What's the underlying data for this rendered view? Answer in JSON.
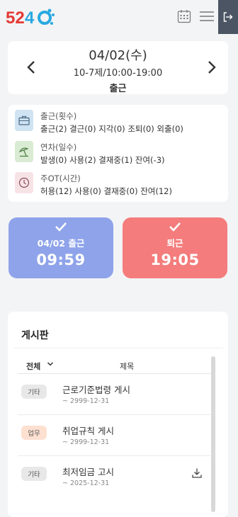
{
  "header": {
    "logo_text": "5240",
    "colors": {
      "logo_red": "#e53935",
      "logo_blue": "#29a9e0",
      "logout_bg": "#4b5563"
    }
  },
  "date_card": {
    "date": "04/02(수)",
    "shift": "10-7제/10:00-19:00",
    "status": "출근"
  },
  "summary": [
    {
      "icon": "briefcase-icon",
      "icon_bg": "#cfe3f2",
      "label": "출근(횟수)",
      "detail": "출근(2) 결근(0) 지각(0) 조퇴(0) 외출(0)"
    },
    {
      "icon": "beach-umbrella-icon",
      "icon_bg": "#d9ecd3",
      "label": "연차(일수)",
      "detail": "발생(0) 사용(2) 결재중(1) 잔여(-3)"
    },
    {
      "icon": "clock-icon",
      "icon_bg": "#f7e3e6",
      "label": "주OT(시간)",
      "detail": "허용(12) 사용(0) 결재중(0) 잔여(12)"
    }
  ],
  "clock_in": {
    "label": "04/02 출근",
    "time": "09:59",
    "color": "#8ea3ea"
  },
  "clock_out": {
    "label": "퇴근",
    "time": "19:05",
    "color": "#f47c7c"
  },
  "board": {
    "title": "게시판",
    "filter_label": "전체",
    "col_title": "제목",
    "posts": [
      {
        "category": "기타",
        "badge_color": "#e8e8e8",
        "title": "근로기준법령 게시",
        "date": "~ 2999-12-31",
        "download": false
      },
      {
        "category": "업무",
        "badge_color": "#fde0d0",
        "title": "취업규칙 게시",
        "date": "~ 2999-12-31",
        "download": false
      },
      {
        "category": "기타",
        "badge_color": "#e8e8e8",
        "title": "최저임금 고시",
        "date": "~ 2025-12-31",
        "download": true
      }
    ]
  }
}
